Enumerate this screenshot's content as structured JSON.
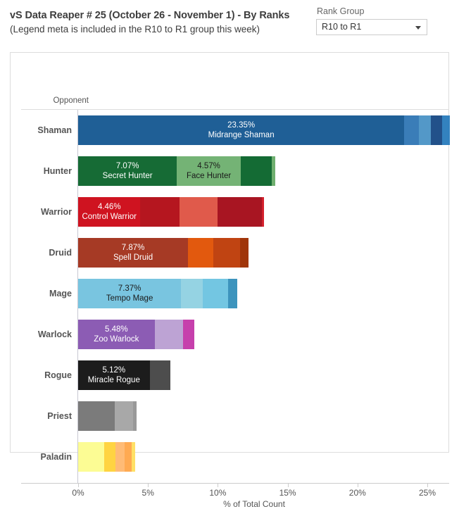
{
  "header": {
    "title_main": "vS Data Reaper # 25 (October 26 - November 1) - By Ranks",
    "title_sub": "(Legend meta is included in the R10 to R1 group this week)",
    "rank_group_label": "Rank Group",
    "rank_group_value": "R10 to R1",
    "dropdown_icon": "chevron-down-icon"
  },
  "chart_data": {
    "type": "bar",
    "orientation": "horizontal",
    "stacked": true,
    "title": "vS Data Reaper # 25 (October 26 - November 1) - By Ranks",
    "xlabel": "% of Total Count",
    "ylabel": "Opponent",
    "xlim": [
      0,
      27
    ],
    "xticks": [
      "0%",
      "5%",
      "10%",
      "15%",
      "20%",
      "25%"
    ],
    "xtick_values": [
      0,
      5,
      10,
      15,
      20,
      25
    ],
    "grid": false,
    "legend": "none",
    "categories": [
      "Shaman",
      "Hunter",
      "Warrior",
      "Druid",
      "Mage",
      "Warlock",
      "Rogue",
      "Priest",
      "Paladin"
    ],
    "totals": [
      26.6,
      14.1,
      13.3,
      12.2,
      11.4,
      8.3,
      6.6,
      4.2,
      4.1
    ],
    "rows": [
      {
        "category": "Shaman",
        "total": 26.6,
        "segments": [
          {
            "value": 23.35,
            "label": "23.35%",
            "name": "Midrange Shaman",
            "color": "#1f5f96",
            "text_color": "#ffffff",
            "show_label": true
          },
          {
            "value": 1.05,
            "label": "",
            "name": "",
            "color": "#3a7db8",
            "text_color": "#ffffff",
            "show_label": false
          },
          {
            "value": 0.85,
            "label": "",
            "name": "",
            "color": "#5398c8",
            "text_color": "#ffffff",
            "show_label": false
          },
          {
            "value": 0.8,
            "label": "",
            "name": "",
            "color": "#22518a",
            "text_color": "#ffffff",
            "show_label": false
          },
          {
            "value": 0.55,
            "label": "",
            "name": "",
            "color": "#3382bf",
            "text_color": "#ffffff",
            "show_label": false
          }
        ]
      },
      {
        "category": "Hunter",
        "total": 14.1,
        "segments": [
          {
            "value": 7.07,
            "label": "7.07%",
            "name": "Secret Hunter",
            "color": "#166b35",
            "text_color": "#ffffff",
            "show_label": true
          },
          {
            "value": 4.57,
            "label": "4.57%",
            "name": "Face Hunter",
            "color": "#74b375",
            "text_color": "#1a1a1a",
            "show_label": true
          },
          {
            "value": 2.2,
            "label": "",
            "name": "",
            "color": "#146b34",
            "text_color": "#ffffff",
            "show_label": false
          },
          {
            "value": 0.26,
            "label": "",
            "name": "",
            "color": "#6faf6f",
            "text_color": "#ffffff",
            "show_label": false
          }
        ]
      },
      {
        "category": "Warrior",
        "total": 13.3,
        "segments": [
          {
            "value": 4.46,
            "label": "4.46%",
            "name": "Control Warrior",
            "color": "#cf1320",
            "text_color": "#ffffff",
            "show_label": true
          },
          {
            "value": 2.8,
            "label": "",
            "name": "",
            "color": "#b5161f",
            "text_color": "#ffffff",
            "show_label": false
          },
          {
            "value": 2.7,
            "label": "",
            "name": "",
            "color": "#e05a4b",
            "text_color": "#ffffff",
            "show_label": false
          },
          {
            "value": 3.2,
            "label": "",
            "name": "",
            "color": "#a81522",
            "text_color": "#ffffff",
            "show_label": false
          },
          {
            "value": 0.14,
            "label": "",
            "name": "",
            "color": "#d4202c",
            "text_color": "#ffffff",
            "show_label": false
          }
        ]
      },
      {
        "category": "Druid",
        "total": 12.2,
        "segments": [
          {
            "value": 7.87,
            "label": "7.87%",
            "name": "Spell Druid",
            "color": "#a63a25",
            "text_color": "#ffffff",
            "show_label": true
          },
          {
            "value": 1.8,
            "label": "",
            "name": "",
            "color": "#e2590e",
            "text_color": "#ffffff",
            "show_label": false
          },
          {
            "value": 1.9,
            "label": "",
            "name": "",
            "color": "#c04412",
            "text_color": "#ffffff",
            "show_label": false
          },
          {
            "value": 0.63,
            "label": "",
            "name": "",
            "color": "#a0360a",
            "text_color": "#ffffff",
            "show_label": false
          }
        ]
      },
      {
        "category": "Mage",
        "total": 11.4,
        "segments": [
          {
            "value": 7.37,
            "label": "7.37%",
            "name": "Tempo Mage",
            "color": "#79c5e0",
            "text_color": "#1a1a1a",
            "show_label": true
          },
          {
            "value": 1.55,
            "label": "",
            "name": "",
            "color": "#95d3e3",
            "text_color": "#1a1a1a",
            "show_label": false
          },
          {
            "value": 1.8,
            "label": "",
            "name": "",
            "color": "#73c6e2",
            "text_color": "#1a1a1a",
            "show_label": false
          },
          {
            "value": 0.68,
            "label": "",
            "name": "",
            "color": "#3d94bd",
            "text_color": "#ffffff",
            "show_label": false
          }
        ]
      },
      {
        "category": "Warlock",
        "total": 8.3,
        "segments": [
          {
            "value": 5.48,
            "label": "5.48%",
            "name": "Zoo Warlock",
            "color": "#8c5cb4",
            "text_color": "#ffffff",
            "show_label": true
          },
          {
            "value": 2.05,
            "label": "",
            "name": "",
            "color": "#bda3d4",
            "text_color": "#1a1a1a",
            "show_label": false
          },
          {
            "value": 0.77,
            "label": "",
            "name": "",
            "color": "#c640ac",
            "text_color": "#ffffff",
            "show_label": false
          }
        ]
      },
      {
        "category": "Rogue",
        "total": 6.6,
        "segments": [
          {
            "value": 5.12,
            "label": "5.12%",
            "name": "Miracle Rogue",
            "color": "#1c1c1c",
            "text_color": "#ffffff",
            "show_label": true
          },
          {
            "value": 1.48,
            "label": "",
            "name": "",
            "color": "#4d4d4d",
            "text_color": "#ffffff",
            "show_label": false
          }
        ]
      },
      {
        "category": "Priest",
        "total": 4.2,
        "segments": [
          {
            "value": 2.6,
            "label": "",
            "name": "",
            "color": "#7b7b7b",
            "text_color": "#ffffff",
            "show_label": false
          },
          {
            "value": 1.32,
            "label": "",
            "name": "",
            "color": "#a8a8a8",
            "text_color": "#ffffff",
            "show_label": false
          },
          {
            "value": 0.28,
            "label": "",
            "name": "",
            "color": "#999999",
            "text_color": "#ffffff",
            "show_label": false
          }
        ]
      },
      {
        "category": "Paladin",
        "total": 4.1,
        "segments": [
          {
            "value": 1.85,
            "label": "",
            "name": "",
            "color": "#fcfc94",
            "text_color": "#1a1a1a",
            "show_label": false
          },
          {
            "value": 0.8,
            "label": "",
            "name": "",
            "color": "#ffd442",
            "text_color": "#1a1a1a",
            "show_label": false
          },
          {
            "value": 0.7,
            "label": "",
            "name": "",
            "color": "#ffbb76",
            "text_color": "#1a1a1a",
            "show_label": false
          },
          {
            "value": 0.5,
            "label": "",
            "name": "",
            "color": "#ffaa52",
            "text_color": "#1a1a1a",
            "show_label": false
          },
          {
            "value": 0.25,
            "label": "",
            "name": "",
            "color": "#ffe066",
            "text_color": "#1a1a1a",
            "show_label": false
          }
        ]
      }
    ]
  }
}
